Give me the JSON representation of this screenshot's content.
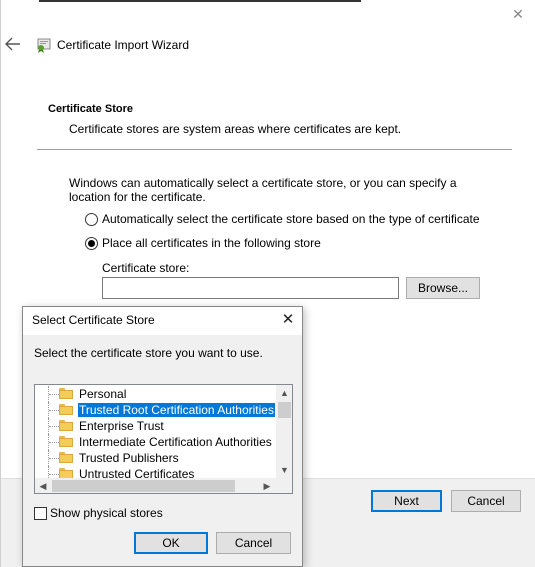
{
  "wizard": {
    "title": "Certificate Import Wizard",
    "section_title": "Certificate Store",
    "section_description": "Certificate stores are system areas where certificates are kept.",
    "explanation": "Windows can automatically select a certificate store, or you can specify a location for the certificate.",
    "option_auto": "Automatically select the certificate store based on the type of certificate",
    "option_place": "Place all certificates in the following store",
    "selected_option": "place",
    "store_label": "Certificate store:",
    "store_value": "",
    "browse_label": "Browse...",
    "next_label": "Next",
    "cancel_label": "Cancel"
  },
  "dialog": {
    "title": "Select Certificate Store",
    "instruction": "Select the certificate store you want to use.",
    "stores": [
      {
        "label": "Personal",
        "selected": false
      },
      {
        "label": "Trusted Root Certification Authorities",
        "selected": true
      },
      {
        "label": "Enterprise Trust",
        "selected": false
      },
      {
        "label": "Intermediate Certification Authorities",
        "selected": false
      },
      {
        "label": "Trusted Publishers",
        "selected": false
      },
      {
        "label": "Untrusted Certificates",
        "selected": false
      }
    ],
    "show_physical_label": "Show physical stores",
    "show_physical_checked": false,
    "ok_label": "OK",
    "cancel_label": "Cancel"
  },
  "colors": {
    "accent": "#0078d7",
    "selection": "#0078d7",
    "folder": "#f5cc5c"
  }
}
